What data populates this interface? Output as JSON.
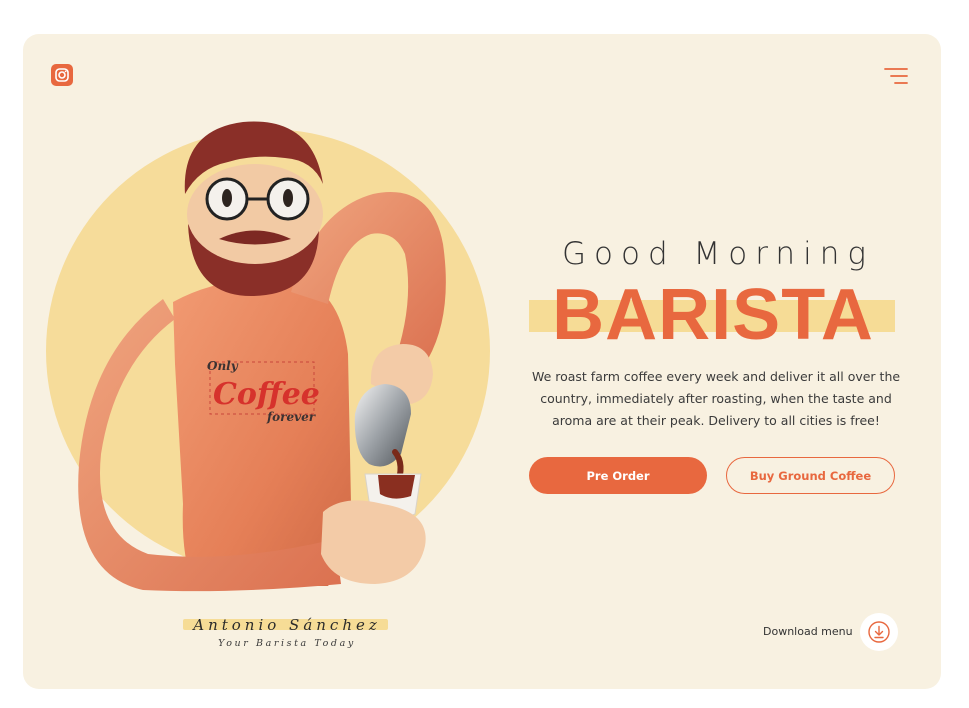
{
  "brand": {
    "logo_icon": "instagram-icon",
    "accent_color": "#e8683f",
    "highlight_color": "#f6dc96",
    "background_color": "#f8f1e1"
  },
  "nav": {
    "menu_icon": "hamburger-menu-icon"
  },
  "hero": {
    "greeting": "Good Morning",
    "title": "BARISTA",
    "description": "We roast farm coffee every week and deliver it all over the country, immediately after roasting, when the taste and aroma are at their peak. Delivery to all cities is free!",
    "primary_button": "Pre Order",
    "secondary_button": "Buy Ground Coffee"
  },
  "barista": {
    "name": "Antonio Sánchez",
    "role": "Your Barista Today"
  },
  "illustration": {
    "shirt_text_top": "Only",
    "shirt_text_main": "Coffee",
    "shirt_text_bottom": "forever"
  },
  "download": {
    "label": "Download menu",
    "icon": "download-circle-icon"
  }
}
